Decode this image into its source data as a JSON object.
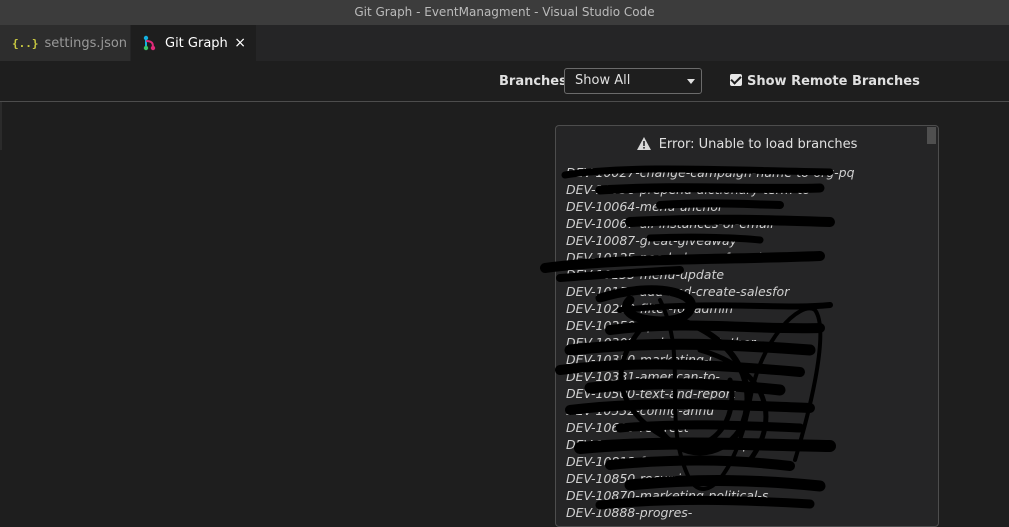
{
  "window": {
    "title": "Git Graph - EventManagment - Visual Studio Code"
  },
  "tabs": [
    {
      "label": "settings.json",
      "icon": "json-icon",
      "icon_glyph": "{..}"
    },
    {
      "label": "Git Graph",
      "icon": "git-graph-icon",
      "close": "×"
    }
  ],
  "controls": {
    "branches_label": "Branches:",
    "branches_value": "Show All",
    "show_remote_label": "Show Remote Branches",
    "show_remote_checked": true
  },
  "error": {
    "title": "Error: Unable to load branches",
    "icon": "warning-icon",
    "branches": [
      "DEV-10027-change-campaign-name-to-org-pq",
      "DEV-10036-prepend-dictionary-term-to-",
      "DEV-10064-menu-anchor",
      "DEV-10067-all-instances-of-email",
      "DEV-10087-great-giveaway",
      "DEV-10125-needed-scan-for-miami",
      "DEV-10135-menu-update",
      "DEV-10153-add-and-create-salesfor",
      "DEV-10200-filter-for-admin",
      "DEV-10250-option-for-s",
      "DEV-10309-and-form-getother",
      "DEV-10350-marketing-i",
      "DEV-10381-american-to-",
      "DEV-10500-text-and-report",
      "DEV-10532-config-annu",
      "DEV-10600-redirect",
      "DEV-10615-remove-create-spec",
      "DEV-10813-form",
      "DEV-10850-recurri",
      "DEV-10870-marketing-political-s",
      "DEV-10888-progres-"
    ]
  },
  "colors": {
    "background": "#1e1e1e",
    "titlebar": "#3c3c3c",
    "json_icon": "#cbcb41",
    "git_icon_primary": "#14b0e0",
    "git_icon_secondary": "#e02a7a"
  }
}
